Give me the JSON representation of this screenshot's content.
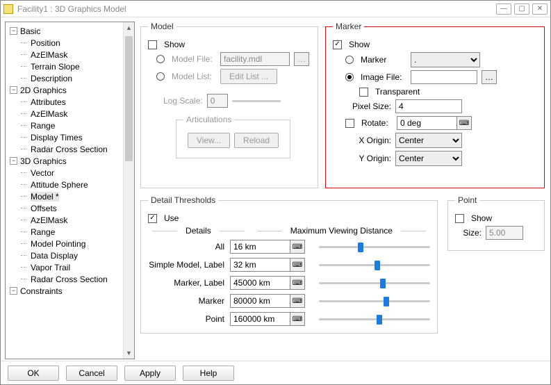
{
  "window": {
    "title": "Facility1 : 3D Graphics Model"
  },
  "tree": {
    "groups": [
      {
        "label": "Basic",
        "items": [
          "Position",
          "AzElMask",
          "Terrain Slope",
          "Description"
        ]
      },
      {
        "label": "2D Graphics",
        "items": [
          "Attributes",
          "AzElMask",
          "Range",
          "Display Times",
          "Radar Cross Section"
        ]
      },
      {
        "label": "3D Graphics",
        "items": [
          "Vector",
          "Attitude Sphere",
          "Model *",
          "Offsets",
          "AzElMask",
          "Range",
          "Model Pointing",
          "Data Display",
          "Vapor Trail",
          "Radar Cross Section"
        ]
      },
      {
        "label": "Constraints",
        "items": []
      }
    ],
    "selected": "Model *"
  },
  "model": {
    "legend": "Model",
    "show_label": "Show",
    "show": false,
    "model_file_label": "Model File:",
    "model_file_value": "facility.mdl",
    "model_list_label": "Model List:",
    "edit_list_btn": "Edit List ...",
    "log_scale_label": "Log Scale:",
    "log_scale_value": "0",
    "articulations_legend": "Articulations",
    "view_btn": "View...",
    "reload_btn": "Reload"
  },
  "marker": {
    "legend": "Marker",
    "show_label": "Show",
    "show": true,
    "marker_radio_label": "Marker",
    "marker_radio": false,
    "marker_select": ".",
    "image_radio_label": "Image File:",
    "image_radio": true,
    "image_value": "",
    "transparent_label": "Transparent",
    "transparent": false,
    "pixel_size_label": "Pixel Size:",
    "pixel_size": "4",
    "rotate_label": "Rotate:",
    "rotate_check": false,
    "rotate_value": "0 deg",
    "x_origin_label": "X Origin:",
    "x_origin": "Center",
    "y_origin_label": "Y Origin:",
    "y_origin": "Center"
  },
  "detail": {
    "legend": "Detail Thresholds",
    "use_label": "Use",
    "use": true,
    "details_hdr": "Details",
    "mvd_hdr": "Maximum Viewing Distance",
    "rows": [
      {
        "label": "All",
        "value": "16 km",
        "pos": 35
      },
      {
        "label": "Simple Model, Label",
        "value": "32 km",
        "pos": 50
      },
      {
        "label": "Marker, Label",
        "value": "45000 km",
        "pos": 55
      },
      {
        "label": "Marker",
        "value": "80000 km",
        "pos": 58
      },
      {
        "label": "Point",
        "value": "160000 km",
        "pos": 52
      }
    ]
  },
  "point": {
    "legend": "Point",
    "show_label": "Show",
    "show": false,
    "size_label": "Size:",
    "size": "5.00"
  },
  "buttons": {
    "ok": "OK",
    "cancel": "Cancel",
    "apply": "Apply",
    "help": "Help"
  }
}
